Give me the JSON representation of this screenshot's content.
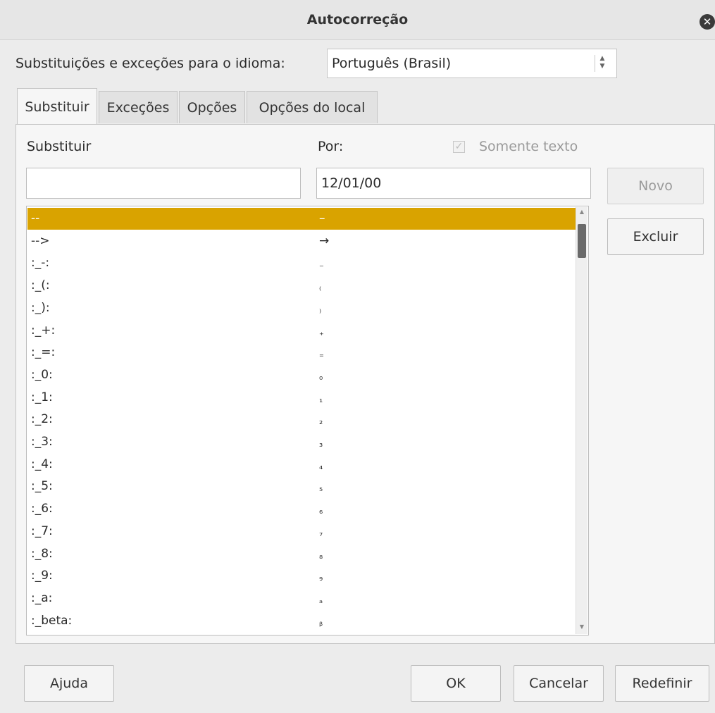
{
  "window": {
    "title": "Autocorreção"
  },
  "language": {
    "label": "Substituições e exceções para o idioma:",
    "value": "Português (Brasil)"
  },
  "tabs": [
    {
      "label": "Substituir"
    },
    {
      "label": "Exceções"
    },
    {
      "label": "Opções"
    },
    {
      "label": "Opções do local"
    }
  ],
  "replace": {
    "replace_label": "Substituir",
    "with_label": "Por:",
    "text_only_label": "Somente texto",
    "replace_value": "",
    "with_value": "12/01/00",
    "new_button": "Novo",
    "delete_button": "Excluir",
    "rows": [
      {
        "from": "--",
        "to": "–"
      },
      {
        "from": "-->",
        "to": "→"
      },
      {
        "from": ":_-:",
        "to": "₋"
      },
      {
        "from": ":_(:",
        "to": "₍"
      },
      {
        "from": ":_):",
        "to": "₎"
      },
      {
        "from": ":_+:",
        "to": "₊"
      },
      {
        "from": ":_=:",
        "to": "₌"
      },
      {
        "from": ":_0:",
        "to": "₀"
      },
      {
        "from": ":_1:",
        "to": "₁"
      },
      {
        "from": ":_2:",
        "to": "₂"
      },
      {
        "from": ":_3:",
        "to": "₃"
      },
      {
        "from": ":_4:",
        "to": "₄"
      },
      {
        "from": ":_5:",
        "to": "₅"
      },
      {
        "from": ":_6:",
        "to": "₆"
      },
      {
        "from": ":_7:",
        "to": "₇"
      },
      {
        "from": ":_8:",
        "to": "₈"
      },
      {
        "from": ":_9:",
        "to": "₉"
      },
      {
        "from": ":_a:",
        "to": "ₐ"
      },
      {
        "from": ":_beta:",
        "to": "ᵦ"
      }
    ]
  },
  "footer": {
    "help": "Ajuda",
    "ok": "OK",
    "cancel": "Cancelar",
    "reset": "Redefinir"
  },
  "colors": {
    "selection": "#d9a300",
    "background": "#ececec"
  }
}
